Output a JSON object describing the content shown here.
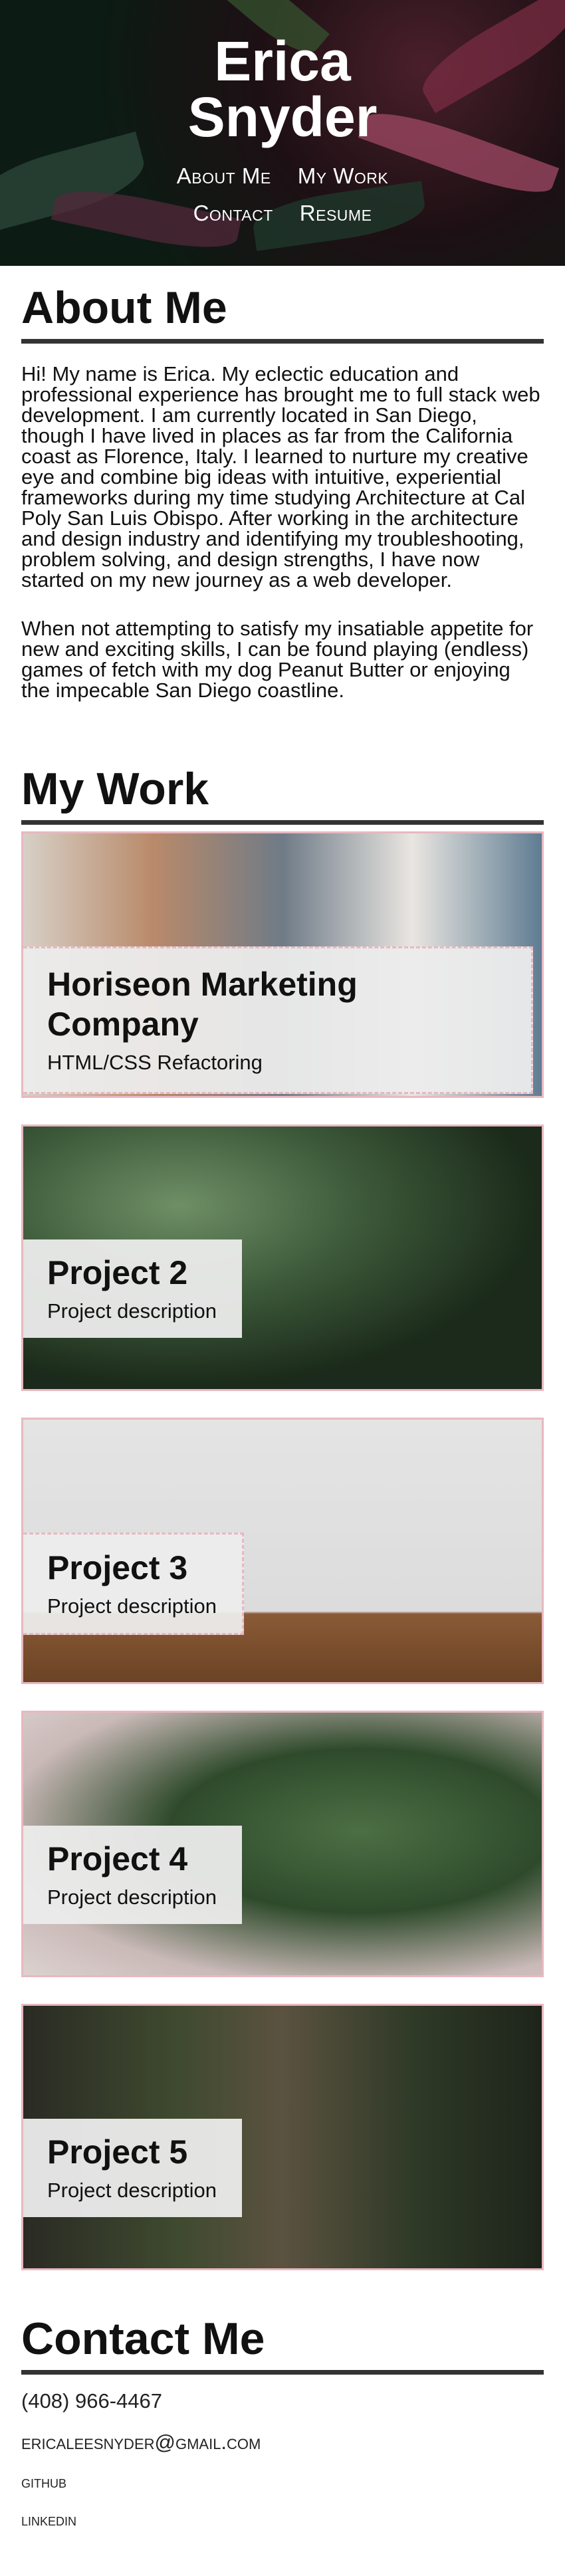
{
  "header": {
    "title_line1": "Erica",
    "title_line2": "Snyder",
    "nav": {
      "about": "About Me",
      "work": "My Work",
      "contact": "Contact",
      "resume": "Resume"
    }
  },
  "about": {
    "heading": "About Me",
    "paragraph1": "Hi! My name is Erica. My eclectic education and professional experience has brought me to full stack web development. I am currently located in San Diego, though I have lived in places as far from the California coast as Florence, Italy. I learned to nurture my creative eye and combine big ideas with intuitive, experiential frameworks during my time studying Architecture at Cal Poly San Luis Obispo. After working in the architecture and design industry and identifying my troubleshooting, problem solving, and design strengths, I have now started on my new journey as a web developer.",
    "paragraph2": "When not attempting to satisfy my insatiable appetite for new and exciting skills, I can be found playing (endless) games of fetch with my dog Peanut Butter or enjoying the impecable San Diego coastline."
  },
  "work": {
    "heading": "My Work",
    "projects": [
      {
        "name": "Horiseon Marketing Company",
        "description": "HTML/CSS Refactoring"
      },
      {
        "name": "Project 2",
        "description": "Project description"
      },
      {
        "name": "Project 3",
        "description": "Project description"
      },
      {
        "name": "Project 4",
        "description": "Project description"
      },
      {
        "name": "Project 5",
        "description": "Project description"
      }
    ]
  },
  "contact": {
    "heading": "Contact Me",
    "phone": "(408) 966-4467",
    "email": "ericaleesnyder@gmail.com",
    "github": "github",
    "linkedin": "linkedin"
  },
  "colors": {
    "rule": "#333333",
    "project_border": "#e8b8c1",
    "card_bg": "#ececec"
  }
}
